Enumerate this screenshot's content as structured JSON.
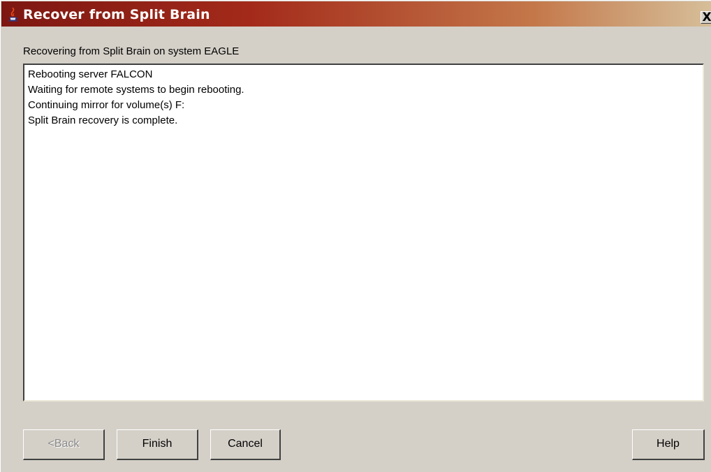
{
  "window": {
    "title": "Recover from Split Brain",
    "close_label": "x"
  },
  "header": {
    "label": "Recovering from Split Brain on system EAGLE"
  },
  "log": {
    "lines": [
      "Rebooting server FALCON",
      "Waiting for remote systems to begin rebooting.",
      "Continuing mirror for volume(s) F:",
      "Split Brain recovery is complete."
    ]
  },
  "buttons": {
    "back": "<Back",
    "finish": "Finish",
    "cancel": "Cancel",
    "help": "Help"
  },
  "colors": {
    "titlebar_start": "#7d1712",
    "titlebar_end": "#d6bf9a",
    "window_bg": "#d4d0c8"
  },
  "icons": {
    "title_icon": "java-cup-icon",
    "close_icon": "close-icon"
  }
}
